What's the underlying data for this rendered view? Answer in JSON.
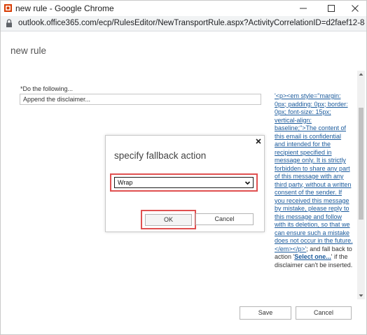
{
  "window": {
    "title": "new rule - Google Chrome"
  },
  "address_bar": {
    "url": "outlook.office365.com/ecp/RulesEditor/NewTransportRule.aspx?ActivityCorrelationID=d2faef12-84ef-48..."
  },
  "page": {
    "title": "new rule",
    "action_label": "*Do the following...",
    "action_value": "Append the disclaimer..."
  },
  "description": {
    "link_text": "'<p><em style=\"margin: 0px; padding: 0px; border: 0px; font-size: 15px; vertical-align: baseline;\">The content of this email is confidential and intended for the recipient specified in message only. It is strictly forbidden to share any part of this message with any third party, without a written consent of the sender. If you received this message by mistake, please reply to this message and follow with its deletion, so that we can ensure such a mistake does not occur in the future.</em></p>'",
    "text_1": "; and fall back to action '",
    "select_link": "Select one...",
    "text_2": "' if the disclaimer can't be inserted."
  },
  "dialog": {
    "title": "specify fallback action",
    "selected_option": "Wrap",
    "ok_label": "OK",
    "cancel_label": "Cancel"
  },
  "footer": {
    "save_label": "Save",
    "cancel_label": "Cancel"
  },
  "colors": {
    "highlight": "#e05050",
    "link": "#1a5a9c"
  }
}
